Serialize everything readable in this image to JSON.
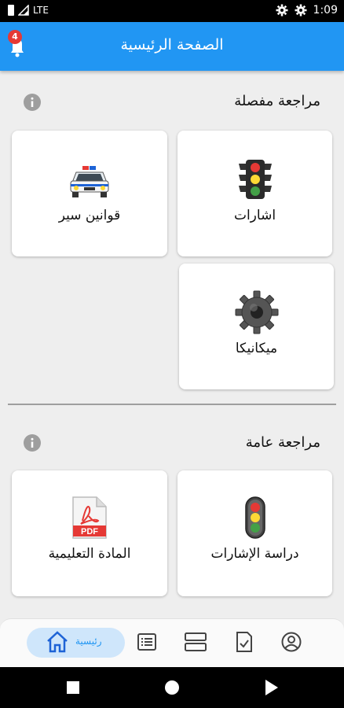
{
  "status_bar": {
    "network": "LTE",
    "time": "1:09"
  },
  "app_bar": {
    "title": "الصفحة الرئيسية",
    "notification_count": "4"
  },
  "sections": {
    "detailed": {
      "title": "مراجعة مفصلة"
    },
    "general": {
      "title": "مراجعة عامة"
    }
  },
  "cards": {
    "signals": {
      "label": "اشارات",
      "icon": "traffic-light-icon"
    },
    "traffic_laws": {
      "label": "قوانين سير",
      "icon": "police-car-icon"
    },
    "mechanics": {
      "label": "ميكانيكا",
      "icon": "gear-icon"
    },
    "study_signals": {
      "label": "دراسة الإشارات",
      "icon": "traffic-light-icon"
    },
    "educational_material": {
      "label": "المادة التعليمية",
      "icon": "pdf-icon",
      "pdf_text": "PDF"
    }
  },
  "bottom_nav": {
    "home_label": "رئيسية",
    "items": [
      "home-icon",
      "list-icon",
      "layout-icon",
      "checklist-icon",
      "profile-icon"
    ]
  },
  "colors": {
    "primary": "#2196f3",
    "badge": "#e53935"
  }
}
